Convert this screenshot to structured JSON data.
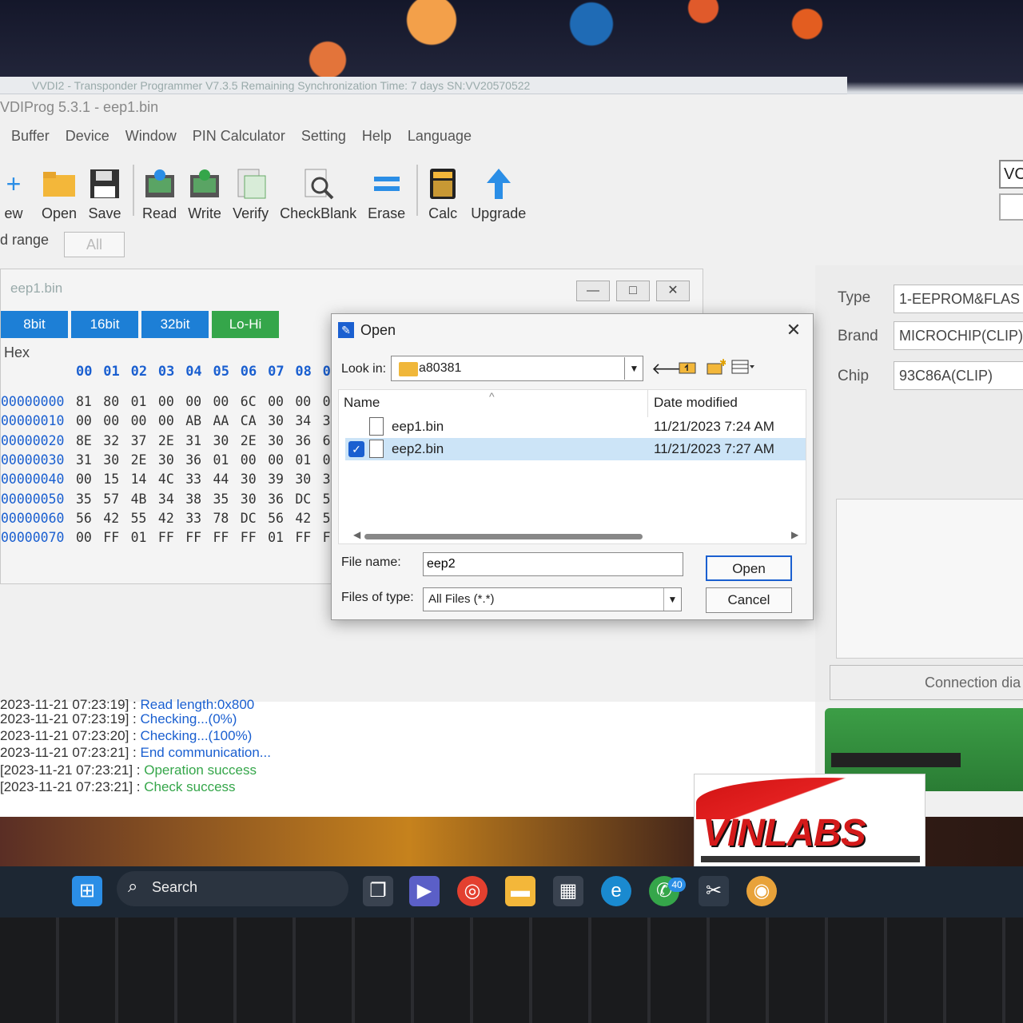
{
  "back_window": {
    "title": "VVDI2 - Transponder Programmer   V7.3.5   Remaining Synchronization Time: 7 days   SN:VV20570522"
  },
  "app": {
    "title": "VDIProg 5.3.1 - eep1.bin",
    "menu": [
      "Buffer",
      "Device",
      "Window",
      "PIN Calculator",
      "Setting",
      "Help",
      "Language"
    ],
    "toolbar": [
      {
        "label": "ew",
        "icon": "new-icon"
      },
      {
        "label": "Open",
        "icon": "folder-icon"
      },
      {
        "label": "Save",
        "icon": "floppy-icon"
      },
      {
        "label": "Read",
        "icon": "read-icon"
      },
      {
        "label": "Write",
        "icon": "write-icon"
      },
      {
        "label": "Verify",
        "icon": "verify-icon"
      },
      {
        "label": "CheckBlank",
        "icon": "checkblank-icon"
      },
      {
        "label": "Erase",
        "icon": "erase-icon"
      },
      {
        "label": "Calc",
        "icon": "calculator-icon"
      },
      {
        "label": "Upgrade",
        "icon": "upload-arrow-icon"
      }
    ],
    "range_label": "d range",
    "range_value": "All",
    "right_top_value": "VC"
  },
  "hex_window": {
    "title": "eep1.bin",
    "tabs": [
      "8bit",
      "16bit",
      "32bit",
      "Lo-Hi"
    ],
    "hex_label": "Hex",
    "columns": [
      "00",
      "01",
      "02",
      "03",
      "04",
      "05",
      "06",
      "07",
      "08",
      "0"
    ],
    "rows": [
      {
        "addr": "00000000",
        "bytes": [
          "81",
          "80",
          "01",
          "00",
          "00",
          "00",
          "6C",
          "00",
          "00",
          "0"
        ]
      },
      {
        "addr": "00000010",
        "bytes": [
          "00",
          "00",
          "00",
          "00",
          "AB",
          "AA",
          "CA",
          "30",
          "34",
          "3"
        ]
      },
      {
        "addr": "00000020",
        "bytes": [
          "8E",
          "32",
          "37",
          "2E",
          "31",
          "30",
          "2E",
          "30",
          "36",
          "6"
        ]
      },
      {
        "addr": "00000030",
        "bytes": [
          "31",
          "30",
          "2E",
          "30",
          "36",
          "01",
          "00",
          "00",
          "01",
          "0"
        ]
      },
      {
        "addr": "00000040",
        "bytes": [
          "00",
          "15",
          "14",
          "4C",
          "33",
          "44",
          "30",
          "39",
          "30",
          "3"
        ]
      },
      {
        "addr": "00000050",
        "bytes": [
          "35",
          "57",
          "4B",
          "34",
          "38",
          "35",
          "30",
          "36",
          "DC",
          "5"
        ]
      },
      {
        "addr": "00000060",
        "bytes": [
          "56",
          "42",
          "55",
          "42",
          "33",
          "78",
          "DC",
          "56",
          "42",
          "5"
        ]
      },
      {
        "addr": "00000070",
        "bytes": [
          "00",
          "FF",
          "01",
          "FF",
          "FF",
          "FF",
          "FF",
          "01",
          "FF",
          "F"
        ]
      }
    ]
  },
  "right_panel": {
    "type_label": "Type",
    "type_value": "1-EEPROM&FLAS",
    "brand_label": "Brand",
    "brand_value": "MICROCHIP(CLIP)",
    "chip_label": "Chip",
    "chip_value": "93C86A(CLIP)",
    "connection_button": "Connection dia"
  },
  "log": [
    {
      "ts": "2023-11-21 07:23:19]",
      "msg": "Read length:0x800",
      "color": "blue"
    },
    {
      "ts": "2023-11-21 07:23:19]",
      "msg": "Checking...(0%)",
      "color": "blue"
    },
    {
      "ts": "2023-11-21 07:23:20]",
      "msg": "Checking...(100%)",
      "color": "blue"
    },
    {
      "ts": "2023-11-21 07:23:21]",
      "msg": "End communication...",
      "color": "blue"
    },
    {
      "ts": "[2023-11-21 07:23:21]",
      "msg": "Operation success",
      "color": "green"
    },
    {
      "ts": "[2023-11-21 07:23:21]",
      "msg": "Check success",
      "color": "green"
    }
  ],
  "dialog": {
    "title": "Open",
    "look_in_label": "Look in:",
    "look_in_value": "a80381",
    "col_name": "Name",
    "col_date": "Date modified",
    "files": [
      {
        "name": "eep1.bin",
        "date": "11/21/2023 7:24 AM",
        "selected": false
      },
      {
        "name": "eep2.bin",
        "date": "11/21/2023 7:27 AM",
        "selected": true
      }
    ],
    "file_name_label": "File name:",
    "file_name_value": "eep2",
    "files_of_type_label": "Files of type:",
    "files_of_type_value": "All Files (*.*)",
    "open_button": "Open",
    "cancel_button": "Cancel"
  },
  "logo": {
    "text": "VINLABS"
  },
  "taskbar": {
    "search_label": "Search",
    "whatsapp_badge": "40"
  }
}
